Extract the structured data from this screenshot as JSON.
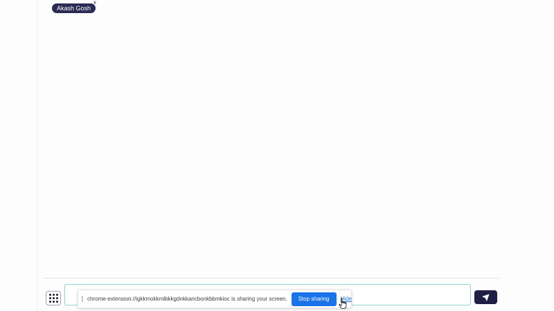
{
  "user_chip": {
    "name": "Akash Gosh",
    "close_label": "x"
  },
  "composer": {
    "message_value": "",
    "send_icon": "paper-plane-icon",
    "grid_icon": "grid-menu-icon"
  },
  "share_bar": {
    "message": "chrome-extension://igkkmokkmlbkkgdnkkancbonkbbmkioc is sharing your screen.",
    "stop_label": "Stop sharing",
    "hide_label": "Hide"
  },
  "colors": {
    "chip_bg": "#2a2a52",
    "send_bg": "#1f1f45",
    "stop_bg": "#1a73e8",
    "input_border": "#8fd3d3"
  }
}
